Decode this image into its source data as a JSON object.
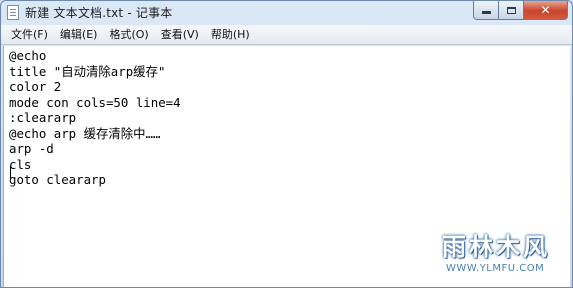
{
  "window": {
    "title": "新建 文本文档.txt - 记事本",
    "app_icon": "notepad-icon",
    "caption_buttons": {
      "minimize": "minimize-icon",
      "maximize": "maximize-icon",
      "close_glyph": "✕"
    }
  },
  "menubar": {
    "items": [
      {
        "label": "文件(F)"
      },
      {
        "label": "编辑(E)"
      },
      {
        "label": "格式(O)"
      },
      {
        "label": "查看(V)"
      },
      {
        "label": "帮助(H)"
      }
    ]
  },
  "editor": {
    "lines": [
      "@echo",
      "title \"自动清除arp缓存\"",
      "color 2",
      "mode con cols=50 line=4",
      ":cleararp",
      "@echo arp 缓存清除中……",
      "arp -d",
      "cls",
      "goto cleararp"
    ]
  },
  "watermark": {
    "title": "雨林木风",
    "url": "WWW.YLMFU.COM"
  },
  "colors": {
    "titlebar": "#c7d9ee",
    "close_button": "#c7452c",
    "editor_background": "#ffffff"
  }
}
